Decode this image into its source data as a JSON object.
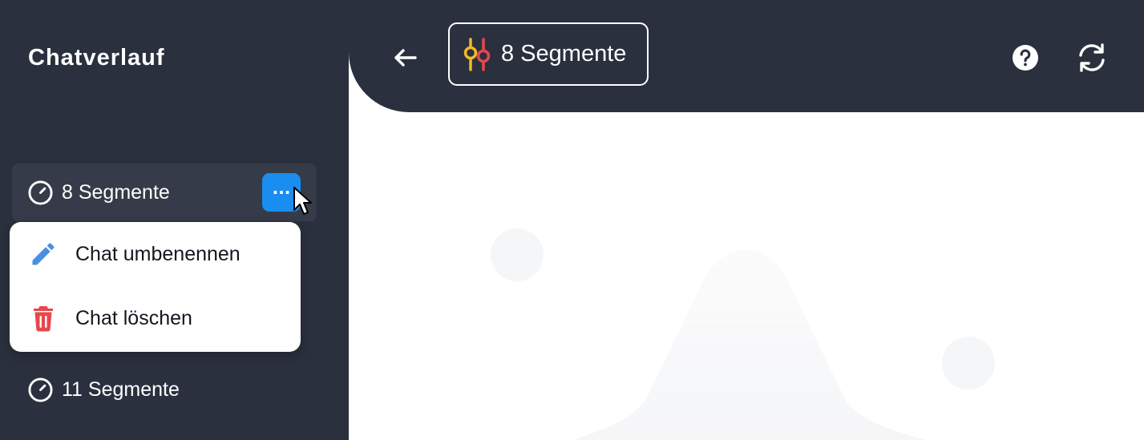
{
  "sidebar": {
    "title": "Chatverlauf",
    "chats": [
      {
        "label": "8 Segmente",
        "icon": "gauge-icon",
        "active": true
      },
      {
        "label": "11 Segmente",
        "icon": "gauge-icon",
        "active": false
      }
    ],
    "more_button_label": "···",
    "context_menu": {
      "items": [
        {
          "label": "Chat umbenennen",
          "icon": "pencil-icon",
          "color": "#4a90e2"
        },
        {
          "label": "Chat löschen",
          "icon": "trash-icon",
          "color": "#e5484d"
        }
      ]
    }
  },
  "header": {
    "back_icon": "arrow-left-icon",
    "segment_chip": {
      "label": "8 Segmente",
      "icon": "segments-icon"
    },
    "help_icon": "help-circle-icon",
    "refresh_icon": "refresh-icon"
  },
  "colors": {
    "dark_bg": "#2a303d",
    "active_item_bg": "#353b48",
    "accent": "#1a8df0",
    "content_bg": "#ffffff",
    "chip_yellow": "#f2b82b",
    "chip_red": "#e5484d"
  }
}
